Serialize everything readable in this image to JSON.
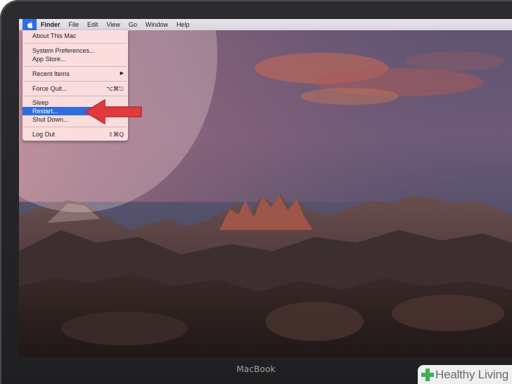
{
  "menubar": {
    "apple_icon": "apple-logo-icon",
    "app_name": "Finder",
    "items": [
      "File",
      "Edit",
      "View",
      "Go",
      "Window",
      "Help"
    ]
  },
  "apple_menu": {
    "about": "About This Mac",
    "system_preferences": "System Preferences...",
    "app_store": "App Store...",
    "recent_items": "Recent Items",
    "recent_items_arrow": "▶",
    "force_quit": "Force Quit...",
    "force_quit_shortcut": "⌥⌘⎋",
    "sleep": "Sleep",
    "restart": "Restart...",
    "shut_down": "Shut Down...",
    "log_out": "Log Out",
    "log_out_shortcut": "⇧⌘Q",
    "selected_item": "Restart..."
  },
  "annotation": {
    "arrow_icon": "pointer-arrow-icon",
    "arrow_color": "#e03a3e"
  },
  "device": {
    "label": "MacBook"
  },
  "watermark": {
    "text": "Healthy Living",
    "icon": "plus-cross-icon",
    "icon_color": "#3fae5a"
  },
  "colors": {
    "highlight": "#2d6fe0",
    "menu_bg": "#ffe2e2",
    "bezel": "#262628"
  }
}
